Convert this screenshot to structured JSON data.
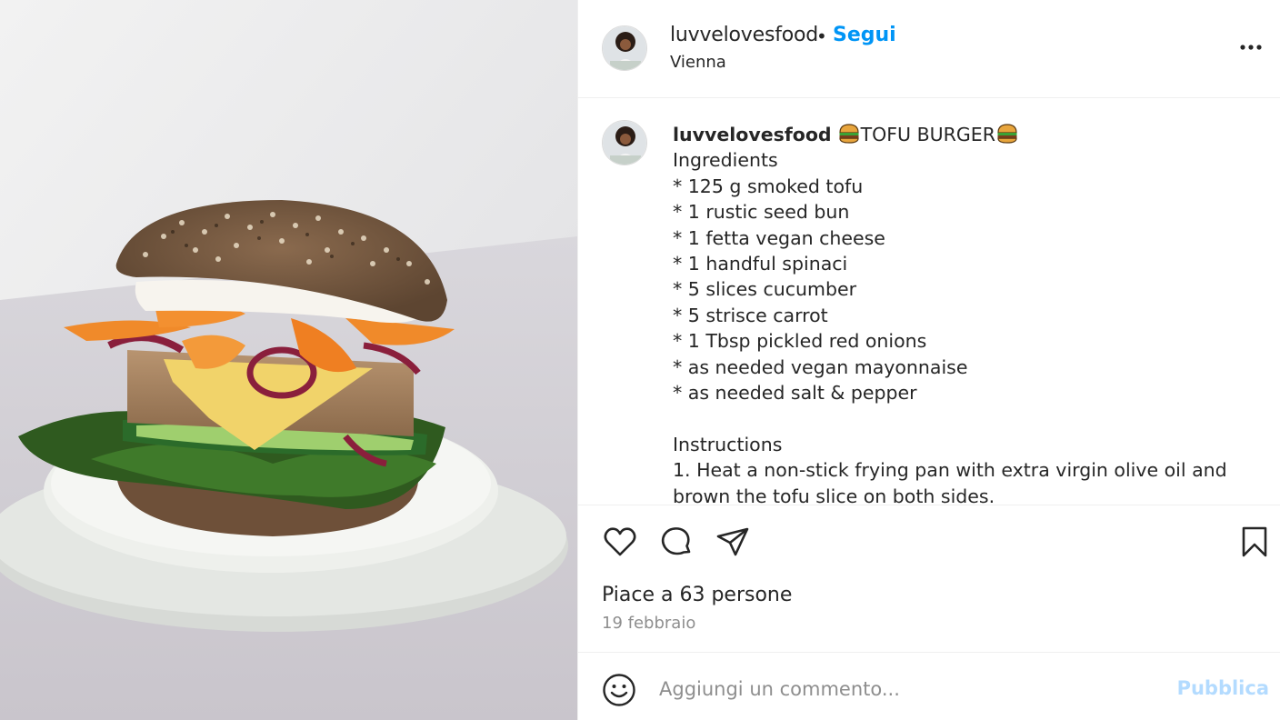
{
  "post": {
    "username": "luvvelovesfood",
    "separator": "•",
    "follow_label": "Segui",
    "location": "Vienna",
    "image_alt": "Tofu burger on a plate",
    "more_icon": "more-options-icon"
  },
  "caption": {
    "username": "luvvelovesfood",
    "title": "TOFU BURGER",
    "lines": [
      "Ingredients",
      "* 125 g smoked tofu",
      "* 1 rustic seed bun",
      "* 1 fetta vegan cheese",
      "* 1 handful spinaci",
      "* 5 slices cucumber",
      "* 5 strisce carrot",
      "* 1 Tbsp pickled red onions",
      "* as needed vegan mayonnaise",
      "* as needed salt & pepper",
      "",
      "Instructions",
      "1. Heat a non-stick frying pan with extra virgin olive oil and brown the tofu slice on both sides."
    ]
  },
  "actions": {
    "like_icon": "heart-icon",
    "comment_icon": "comment-icon",
    "share_icon": "share-icon",
    "save_icon": "bookmark-icon",
    "likes_text": "Piace a 63 persone",
    "date_text": "19 febbraio"
  },
  "comment_box": {
    "placeholder": "Aggiungi un commento...",
    "publish_label": "Pubblica",
    "emoji_icon": "emoji-icon"
  },
  "colors": {
    "accent": "#0095f6",
    "publish_disabled": "#b3dbff",
    "secondary_text": "#8e8e8e"
  }
}
